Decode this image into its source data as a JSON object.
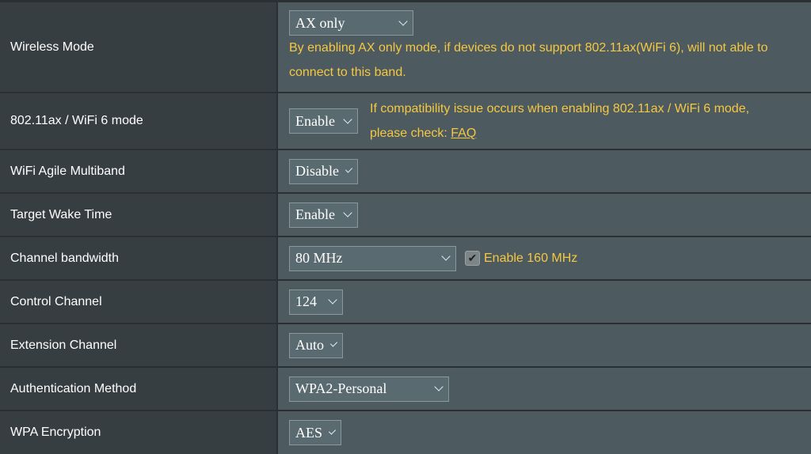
{
  "rows": [
    {
      "label": "Wireless Mode",
      "value": "AX only",
      "hint": "By enabling AX only mode, if devices do not support 802.11ax(WiFi 6), will not able to connect to this band."
    },
    {
      "label": "802.11ax / WiFi 6 mode",
      "value": "Enable",
      "hint": "If compatibility issue occurs when enabling 802.11ax / WiFi 6 mode, please check: ",
      "link": "FAQ"
    },
    {
      "label": "WiFi Agile Multiband",
      "value": "Disable"
    },
    {
      "label": "Target Wake Time",
      "value": "Enable"
    },
    {
      "label": "Channel bandwidth",
      "value": "80 MHz",
      "checkbox_label": "Enable 160 MHz",
      "checkbox_checked": true
    },
    {
      "label": "Control Channel",
      "value": "124"
    },
    {
      "label": "Extension Channel",
      "value": "Auto"
    },
    {
      "label": "Authentication Method",
      "value": "WPA2-Personal"
    },
    {
      "label": "WPA Encryption",
      "value": "AES"
    }
  ],
  "colors": {
    "hint": "#f5c842",
    "label_bg": "#373e41",
    "value_bg": "#4d5a5f"
  }
}
